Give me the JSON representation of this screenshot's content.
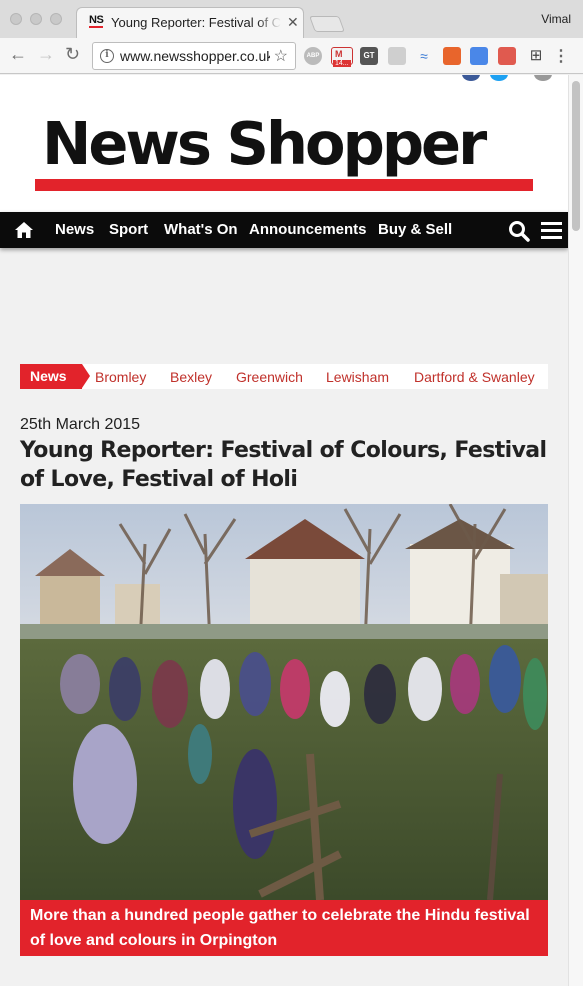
{
  "browser": {
    "tab_title": "Young Reporter: Festival of Colours",
    "tab_favicon": "NS",
    "tab_close": "✕",
    "profile_name": "Vimal",
    "url": "www.newsshopper.co.uk",
    "gmail_badge": "14...",
    "ext_abp": "ABP",
    "ext_gt": "GT",
    "icons": {
      "back": "←",
      "forward": "→",
      "reload": "↻",
      "info": "i",
      "star": "☆",
      "grid": "⊞",
      "menu": "⋮",
      "wave": "≈"
    }
  },
  "site": {
    "logo": "News Shopper",
    "brand_red": "#e2232b",
    "nav": {
      "items": [
        "News",
        "Sport",
        "What's On",
        "Announcements",
        "Buy & Sell"
      ]
    },
    "sections": {
      "active": "News",
      "links": [
        "Bromley",
        "Bexley",
        "Greenwich",
        "Lewisham",
        "Dartford & Swanley"
      ]
    }
  },
  "article": {
    "date": "25th March 2015",
    "title": "Young Reporter: Festival of Colours, Festival of Love, Festival of Holi",
    "caption": "More than a hundred people gather to celebrate the Hindu festival of love and colours in Orpington"
  }
}
